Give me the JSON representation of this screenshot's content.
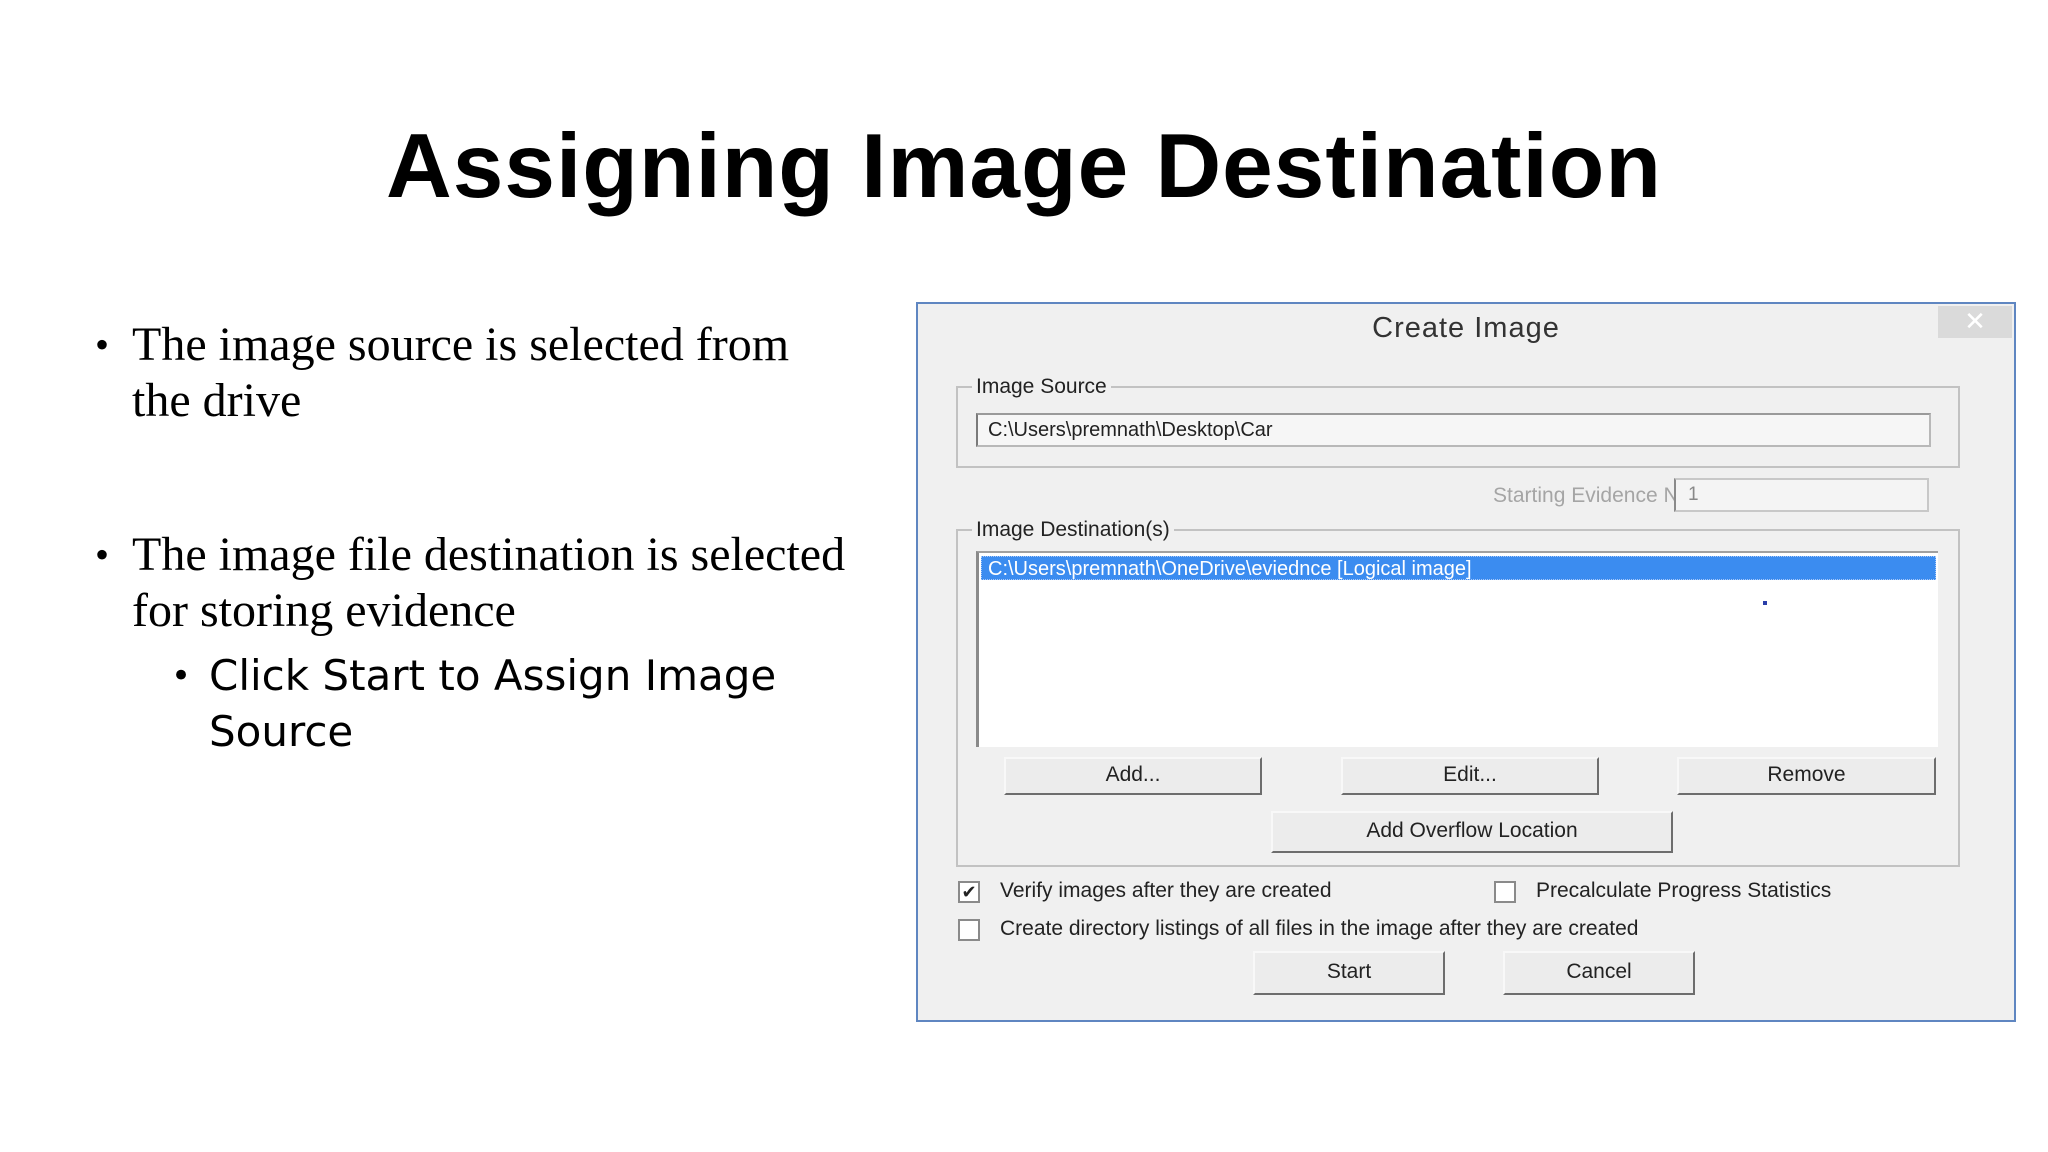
{
  "slide": {
    "title": "Assigning Image Destination",
    "bullets": [
      "The image source is selected from the drive",
      "The image file destination is selected for storing evidence"
    ],
    "sub_bullets": [
      "Click Start to Assign Image Source"
    ],
    "bullet_glyph": "•"
  },
  "dialog": {
    "title": "Create Image",
    "close_label": "✕",
    "image_source": {
      "label": "Image Source",
      "value": "C:\\Users\\premnath\\Desktop\\Car"
    },
    "evidence": {
      "label": "Starting Evidence Number:",
      "value": "1"
    },
    "image_destinations": {
      "label": "Image Destination(s)",
      "items": [
        "C:\\Users\\premnath\\OneDrive\\eviednce [Logical image]"
      ],
      "selected_index": 0
    },
    "buttons": {
      "add": "Add...",
      "edit": "Edit...",
      "remove": "Remove",
      "add_overflow": "Add Overflow Location",
      "start": "Start",
      "cancel": "Cancel"
    },
    "options": {
      "verify": {
        "label": "Verify images after they are created",
        "checked": true
      },
      "precalculate": {
        "label": "Precalculate Progress Statistics",
        "checked": false
      },
      "directory_listings": {
        "label": "Create directory listings of all files in the image after they are created",
        "checked": false
      }
    },
    "colors": {
      "selection": "#3b8cf0",
      "border": "#5f86c1"
    }
  }
}
